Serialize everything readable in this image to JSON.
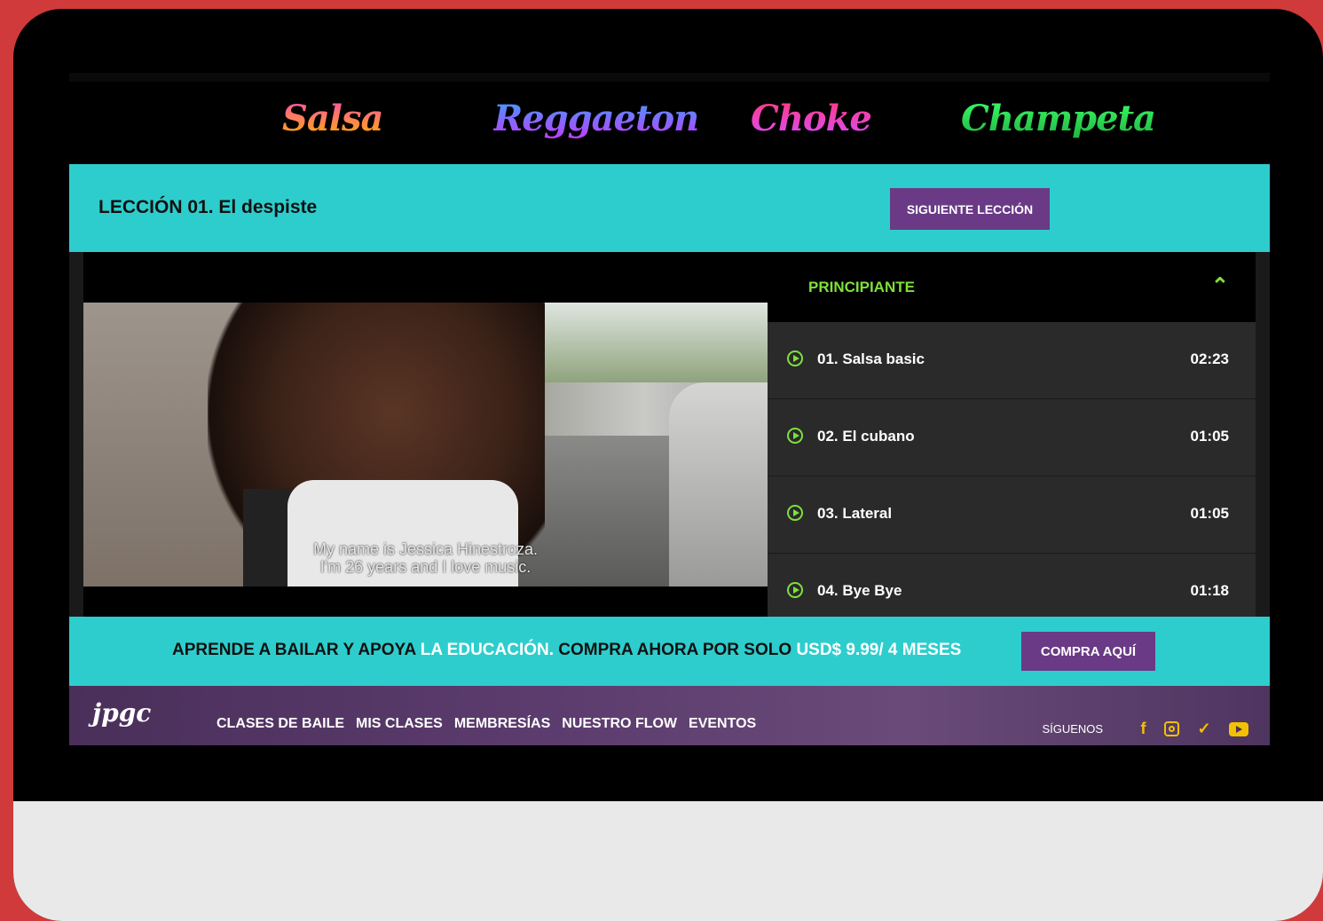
{
  "genres": [
    "Salsa",
    "Reggaeton",
    "Choke",
    "Champeta"
  ],
  "lesson": {
    "title": "LECCIÓN 01. El despiste",
    "next_label": "SIGUIENTE LECCIÓN"
  },
  "video": {
    "subtitle_line1": "My name is Jessica Hinestroza.",
    "subtitle_line2": "I'm 26 years and I love music."
  },
  "playlist": {
    "level": "PRINCIPIANTE",
    "items": [
      {
        "name": "01. Salsa basic",
        "duration": "02:23"
      },
      {
        "name": "02. El cubano",
        "duration": "01:05"
      },
      {
        "name": "03. Lateral",
        "duration": "01:05"
      },
      {
        "name": "04. Bye Bye",
        "duration": "01:18"
      }
    ]
  },
  "promo": {
    "part1": "APRENDE A BAILAR Y APOYA ",
    "part2": "LA EDUCACIÓN.",
    "part3": " COMPRA AHORA POR SOLO ",
    "part4": "USD$ 9.99/ 4 MESES",
    "button": "COMPRA AQUÍ"
  },
  "footer": {
    "logo": "jpgc",
    "nav": [
      "CLASES DE BAILE",
      "MIS CLASES",
      "MEMBRESÍAS",
      "NUESTRO FLOW",
      "EVENTOS"
    ],
    "follow_label": "SÍGUENOS",
    "social_icons": [
      "facebook-icon",
      "instagram-icon",
      "twitter-icon",
      "youtube-icon"
    ]
  },
  "colors": {
    "frame": "#d13a3a",
    "cyan": "#2ecdcd",
    "purple": "#6a3a86",
    "green": "#7fe03a"
  }
}
